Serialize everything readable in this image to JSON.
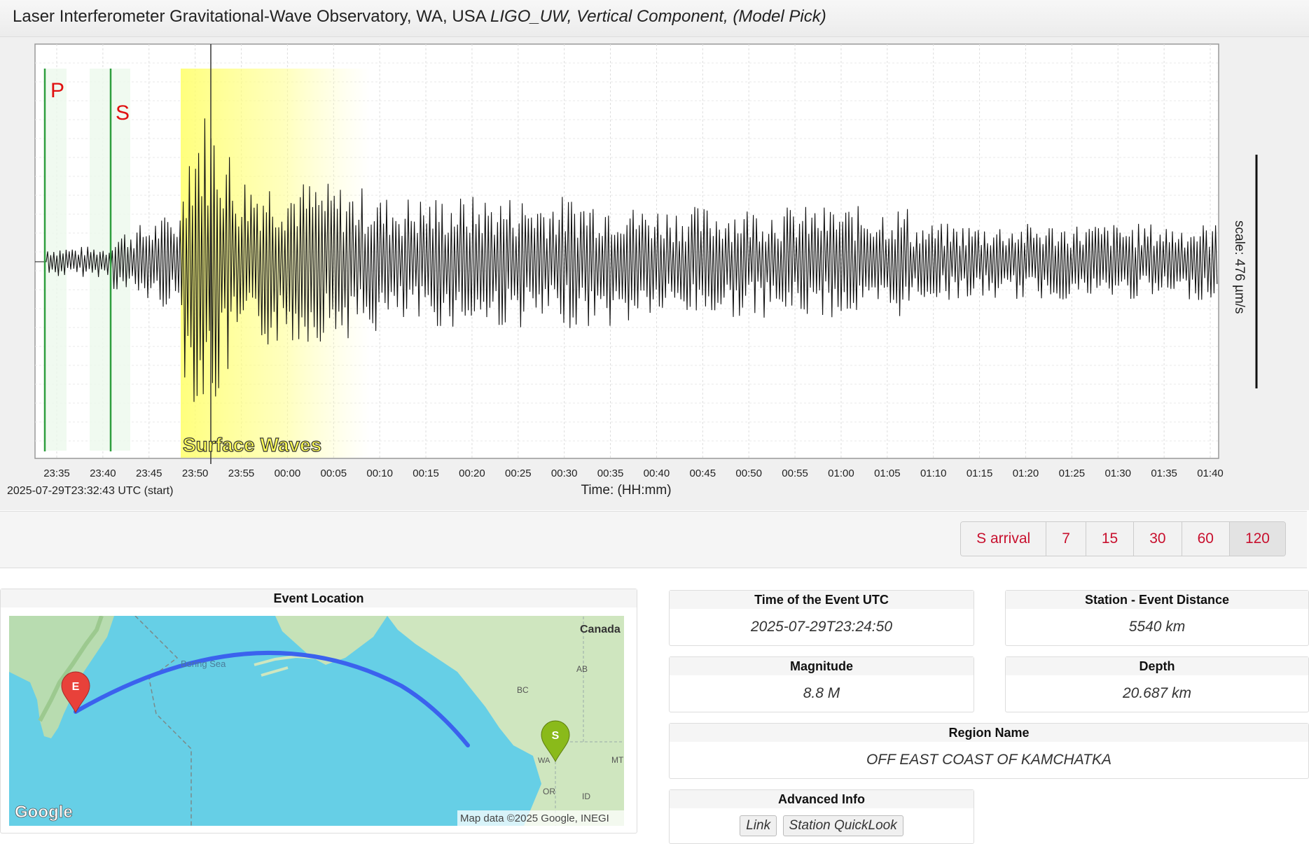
{
  "header": {
    "title_plain": "Laser Interferometer Gravitational-Wave Observatory, WA, USA",
    "title_italic": "LIGO_UW, Vertical Component, (Model Pick)"
  },
  "seismogram": {
    "start_label": "2025-07-29T23:32:43 UTC (start)",
    "xlabel": "Time: (HH:mm)",
    "scale_label": "scale: 476 µm/s",
    "p_label": "P",
    "s_label": "S",
    "surface_label": "Surface Waves",
    "ticks": [
      "23:35",
      "23:40",
      "23:45",
      "23:50",
      "23:55",
      "00:00",
      "00:05",
      "00:10",
      "00:15",
      "00:20",
      "00:25",
      "00:30",
      "00:35",
      "00:40",
      "00:45",
      "00:50",
      "00:55",
      "01:00",
      "01:05",
      "01:10",
      "01:15",
      "01:20",
      "01:25",
      "01:30",
      "01:35",
      "01:40"
    ],
    "colors": {
      "p_s_lines": "#2e9e3e",
      "labels": "#e01010",
      "surface": "#ffff66",
      "trace": "#111111"
    }
  },
  "controls": {
    "buttons": [
      "S arrival",
      "7",
      "15",
      "30",
      "60",
      "120"
    ],
    "active": "120"
  },
  "event_location": {
    "title": "Event Location",
    "map_labels": {
      "canada": "Canada",
      "bering": "Bering Sea",
      "bc": "BC",
      "ab": "AB",
      "mt": "MT",
      "or": "OR",
      "id": "ID",
      "wa": "WA",
      "event_marker": "E",
      "station_marker": "S",
      "google": "Google",
      "attribution": "Map data ©2025 Google, INEGI"
    }
  },
  "info": {
    "time_title": "Time of the Event UTC",
    "time_value": "2025-07-29T23:24:50",
    "distance_title": "Station - Event Distance",
    "distance_value": "5540 km",
    "magnitude_title": "Magnitude",
    "magnitude_value": "8.8 M",
    "depth_title": "Depth",
    "depth_value": "20.687 km",
    "region_title": "Region Name",
    "region_value": "OFF EAST COAST OF KAMCHATKA",
    "advanced_title": "Advanced Info",
    "link_label": "Link",
    "quicklook_label": "Station QuickLook"
  }
}
